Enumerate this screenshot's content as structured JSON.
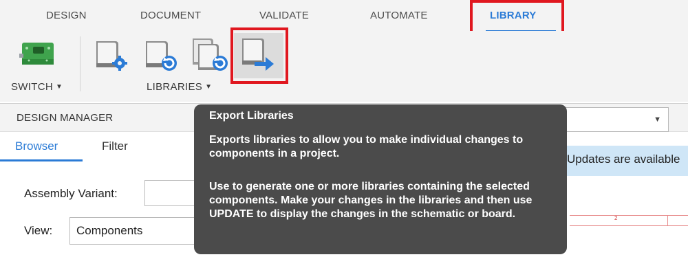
{
  "tabs": [
    {
      "label": "DESIGN",
      "active": false
    },
    {
      "label": "DOCUMENT",
      "active": false
    },
    {
      "label": "VALIDATE",
      "active": false
    },
    {
      "label": "AUTOMATE",
      "active": false
    },
    {
      "label": "LIBRARY",
      "active": true
    }
  ],
  "ribbon": {
    "switch_label": "SWITCH",
    "libraries_label": "LIBRARIES",
    "caret": "▼",
    "icons": [
      "switch-board-icon",
      "library-settings-icon",
      "library-refresh-icon",
      "libraries-refresh-icon",
      "export-libraries-icon"
    ]
  },
  "panel": {
    "title": "DESIGN MANAGER",
    "subtabs": [
      "Browser",
      "Filter"
    ],
    "assembly_variant_label": "Assembly Variant:",
    "assembly_variant_value": "",
    "view_label": "View:",
    "view_value": "Components",
    "dropdown_value": "",
    "dropdown_caret": "▼",
    "banner_text": "Updates are available",
    "schematic_marker": "2"
  },
  "tooltip": {
    "title": "Export Libraries",
    "paragraph1": "Exports libraries to allow you to make individual changes to components in a project.",
    "paragraph2": "Use to generate one or more libraries containing the selected components. Make your changes in the libraries and then use UPDATE to display the changes in the schematic or board."
  },
  "colors": {
    "accent": "#2b7bd6",
    "highlight_box": "#e0171f",
    "tooltip_bg": "#4b4b4b",
    "banner_bg": "#cfe6f7"
  }
}
